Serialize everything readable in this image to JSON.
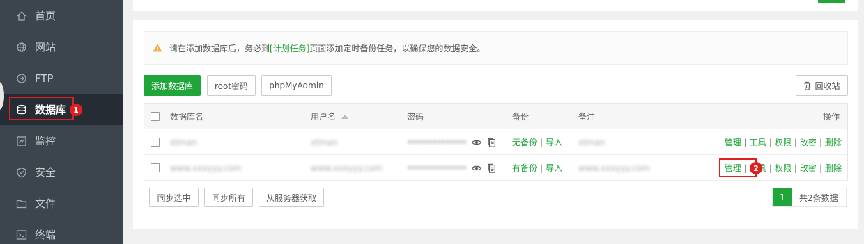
{
  "sidebar": {
    "items": [
      {
        "label": "首页",
        "icon": "home-icon"
      },
      {
        "label": "网站",
        "icon": "globe-icon"
      },
      {
        "label": "FTP",
        "icon": "ftp-icon"
      },
      {
        "label": "数据库",
        "icon": "database-icon"
      },
      {
        "label": "监控",
        "icon": "monitor-icon"
      },
      {
        "label": "安全",
        "icon": "shield-icon"
      },
      {
        "label": "文件",
        "icon": "folder-icon"
      },
      {
        "label": "终端",
        "icon": "terminal-icon"
      }
    ],
    "active": "数据库"
  },
  "annotations": {
    "badge1": "1",
    "badge2": "2"
  },
  "alert": {
    "prefix": "请在添加数据库后，务必到",
    "link": "[计划任务]",
    "suffix": "页面添加定时备份任务，以确保您的数据安全。"
  },
  "toolbar": {
    "add_db": "添加数据库",
    "root_pw": "root密码",
    "phpmyadmin": "phpMyAdmin",
    "recycle": "回收站"
  },
  "table": {
    "headers": {
      "name": "数据库名",
      "user": "用户名",
      "password": "密码",
      "backup": "备份",
      "note": "备注",
      "ops": "操作"
    },
    "rows": [
      {
        "name": "xtman",
        "user": "xtman",
        "password": "••••••••••••••",
        "backup_status": "无备份",
        "import": "导入",
        "note": "xtman",
        "ops": [
          "管理",
          "工具",
          "权限",
          "改密",
          "删除"
        ]
      },
      {
        "name": "www.xxxyyy.com",
        "user": "www.xxxyyy.com",
        "password": "••••••••••••••",
        "backup_status": "有备份",
        "import": "导入",
        "note": "www.xxxyyy.com",
        "ops": [
          "管理",
          "工具",
          "权限",
          "改密",
          "删除"
        ]
      }
    ]
  },
  "footer": {
    "sync_selected": "同步选中",
    "sync_all": "同步所有",
    "fetch_server": "从服务器获取",
    "page": "1",
    "total": "共2条数据"
  },
  "colors": {
    "accent": "#20a53a",
    "sidebar_bg": "#3c444d",
    "highlight": "#e02020"
  }
}
